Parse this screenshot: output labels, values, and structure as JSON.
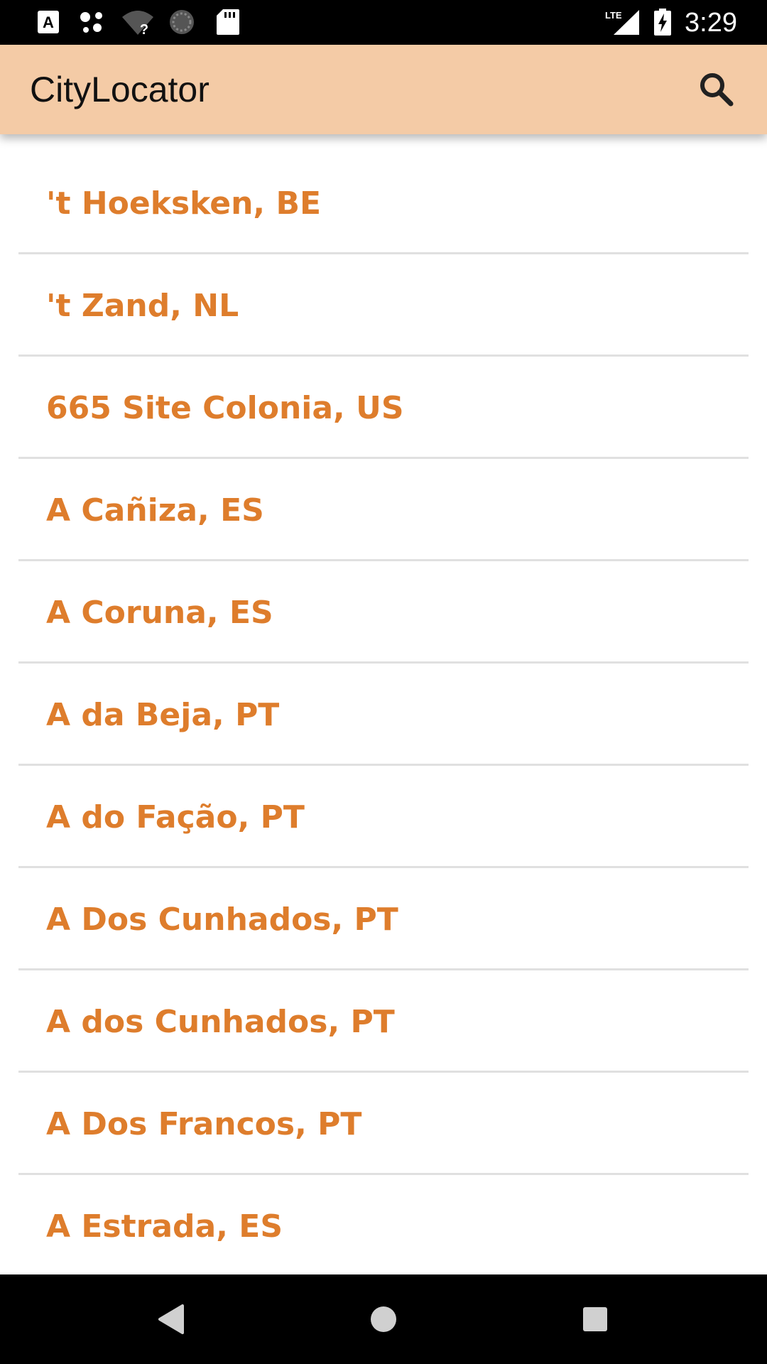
{
  "status_bar": {
    "time": "3:29",
    "icons": [
      "keyboard-a-icon",
      "assistant-dots-icon",
      "wifi-question-icon",
      "sync-circle-icon",
      "sd-card-icon",
      "lte-signal-icon",
      "battery-charging-icon"
    ]
  },
  "app_bar": {
    "title": "CityLocator",
    "search_icon": "search-icon"
  },
  "cities": [
    "'t Hoeksken, BE",
    "'t Zand, NL",
    "665 Site Colonia, US",
    "A Cañiza, ES",
    "A Coruna, ES",
    "A da Beja, PT",
    "A do Fação, PT",
    "A Dos Cunhados, PT",
    "A dos Cunhados, PT",
    "A Dos Francos, PT",
    "A Estrada, ES"
  ],
  "nav_bar": {
    "back_icon": "back-triangle-icon",
    "home_icon": "home-circle-icon",
    "recents_icon": "recents-square-icon"
  },
  "colors": {
    "app_bar": "#f4cba6",
    "accent_text": "#de7d2c",
    "divider": "#e0e0e0"
  }
}
